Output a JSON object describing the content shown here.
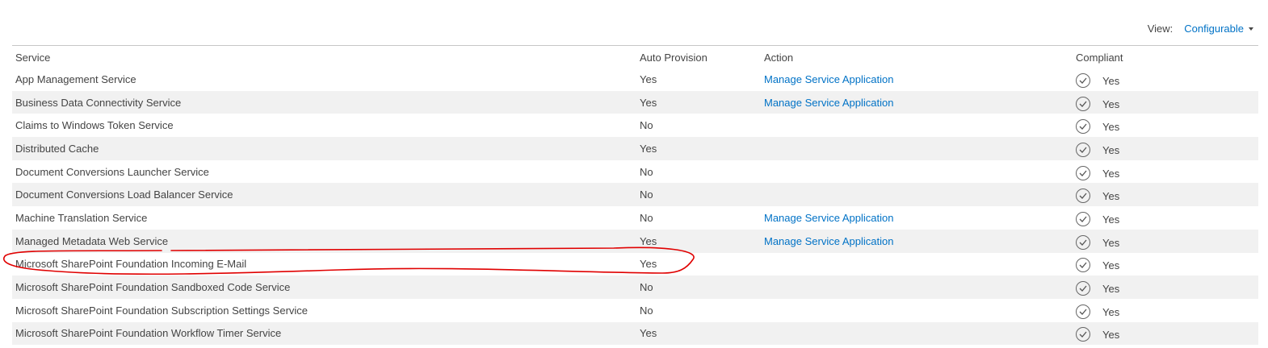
{
  "view": {
    "label": "View:",
    "value": "Configurable"
  },
  "columns": {
    "service": "Service",
    "auto": "Auto Provision",
    "action": "Action",
    "compliant": "Compliant"
  },
  "rows": [
    {
      "service": "App Management Service",
      "auto": "Yes",
      "action": "Manage Service Application",
      "compliant": "Yes"
    },
    {
      "service": "Business Data Connectivity Service",
      "auto": "Yes",
      "action": "Manage Service Application",
      "compliant": "Yes"
    },
    {
      "service": "Claims to Windows Token Service",
      "auto": "No",
      "action": "",
      "compliant": "Yes"
    },
    {
      "service": "Distributed Cache",
      "auto": "Yes",
      "action": "",
      "compliant": "Yes"
    },
    {
      "service": "Document Conversions Launcher Service",
      "auto": "No",
      "action": "",
      "compliant": "Yes"
    },
    {
      "service": "Document Conversions Load Balancer Service",
      "auto": "No",
      "action": "",
      "compliant": "Yes"
    },
    {
      "service": "Machine Translation Service",
      "auto": "No",
      "action": "Manage Service Application",
      "compliant": "Yes"
    },
    {
      "service": "Managed Metadata Web Service",
      "auto": "Yes",
      "action": "Manage Service Application",
      "compliant": "Yes"
    },
    {
      "service": "Microsoft SharePoint Foundation Incoming E-Mail",
      "auto": "Yes",
      "action": "",
      "compliant": "Yes"
    },
    {
      "service": "Microsoft SharePoint Foundation Sandboxed Code Service",
      "auto": "No",
      "action": "",
      "compliant": "Yes"
    },
    {
      "service": "Microsoft SharePoint Foundation Subscription Settings Service",
      "auto": "No",
      "action": "",
      "compliant": "Yes"
    },
    {
      "service": "Microsoft SharePoint Foundation Workflow Timer Service",
      "auto": "Yes",
      "action": "",
      "compliant": "Yes"
    }
  ],
  "colors": {
    "link": "#0072c6",
    "text": "#444444",
    "alt_row": "#f1f1f1",
    "annotation": "#e00000"
  },
  "icons": {
    "compliant": "check-circle-icon",
    "dropdown": "caret-down-icon"
  }
}
